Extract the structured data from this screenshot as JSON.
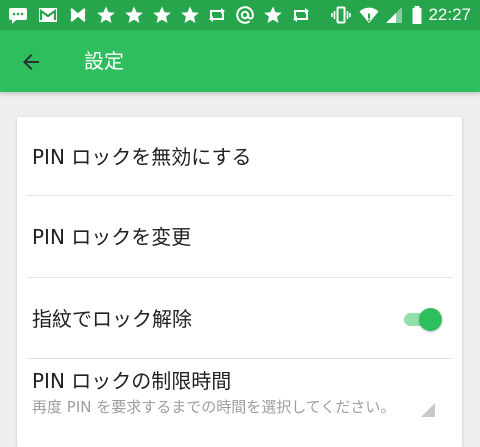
{
  "status_bar": {
    "time": "22:27",
    "icons": [
      "chat-icon",
      "gmail-icon",
      "mail-icon",
      "star-icon",
      "star-icon",
      "star-icon",
      "star-icon",
      "retweet-icon",
      "at-icon",
      "star-icon",
      "retweet-icon",
      "vibrate-icon",
      "wifi-icon",
      "signal-icon",
      "battery-icon"
    ]
  },
  "app_bar": {
    "title": "設定",
    "back_icon": "arrow-left-icon"
  },
  "settings": {
    "disable_pin": "PIN ロックを無効にする",
    "change_pin": "PIN ロックを変更",
    "fingerprint_unlock": "指紋でロック解除",
    "fingerprint_enabled": true,
    "pin_time_limit": "PIN ロックの制限時間",
    "pin_time_limit_summary": "再度 PIN を要求するまでの時間を選択してください。"
  },
  "colors": {
    "status_bar": "#27a54d",
    "app_bar": "#2ebe5e",
    "accent": "#2ebe5e",
    "background": "#eeeeee"
  }
}
